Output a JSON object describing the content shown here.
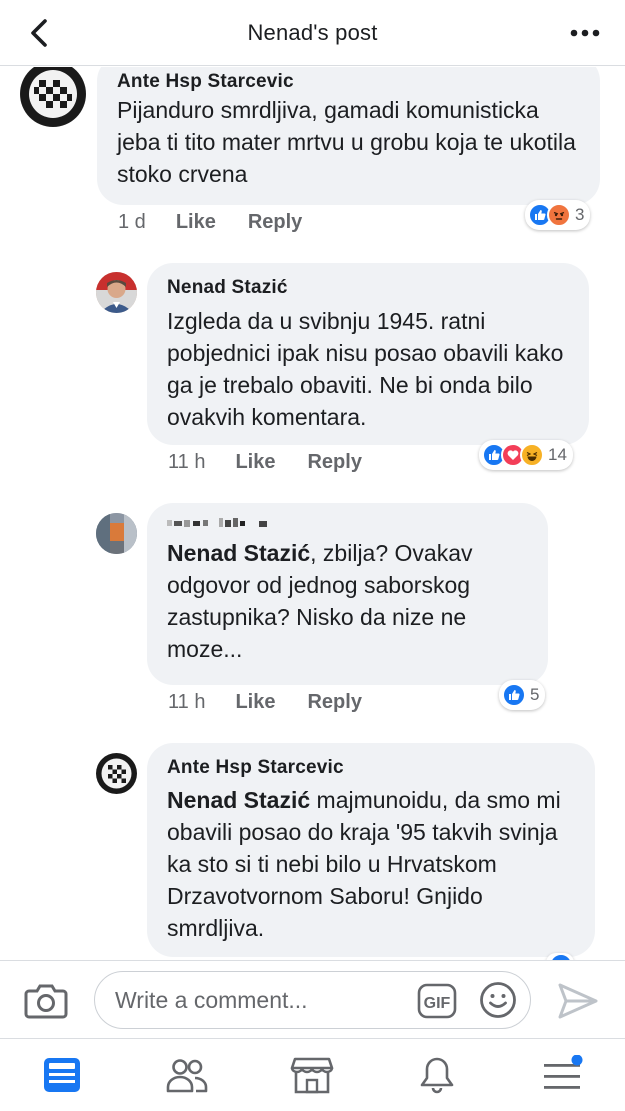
{
  "header": {
    "title": "Nenad's post",
    "back_icon": "chevron-left-icon",
    "more_icon": "more-dots-icon"
  },
  "comments": [
    {
      "author": "Ante Hsp Starcevic",
      "text": "Pijanduro smrdljiva, gamadi komunisticka jeba ti tito mater mrtvu u grobu koja te ukotila stoko crvena",
      "time": "1 d",
      "like": "Like",
      "reply": "Reply",
      "reactions": [
        "like",
        "angry"
      ],
      "reaction_count": "3"
    },
    {
      "author": "Nenad Stazić",
      "text": "Izgleda da u svibnju 1945. ratni pobjednici ipak nisu posao obavili kako ga je trebalo obaviti. Ne bi onda bilo ovakvih komentara.",
      "time": "11 h",
      "like": "Like",
      "reply": "Reply",
      "reactions": [
        "like",
        "love",
        "haha"
      ],
      "reaction_count": "14"
    },
    {
      "author": "",
      "mention": "Nenad Stazić",
      "text": ", zbilja? Ovakav odgovor od jednog saborskog zastupnika? Nisko da nize ne moze...",
      "time": "11 h",
      "like": "Like",
      "reply": "Reply",
      "reactions": [
        "like"
      ],
      "reaction_count": "5"
    },
    {
      "author": "Ante Hsp Starcevic",
      "mention": "Nenad Stazić",
      "text": " majmunoidu, da smo mi obavili posao do kraja '95 takvih svinja ka sto si ti nebi bilo u Hrvatskom Drzavotvornom Saboru!  Gnjido smrdljiva."
    }
  ],
  "composer": {
    "placeholder": "Write a comment...",
    "gif_label": "GIF"
  },
  "colors": {
    "accent": "#1877f2",
    "bubble": "#f0f2f5",
    "meta": "#65676b",
    "angry": "#f0743e",
    "love": "#f33e58",
    "haha": "#f7b125"
  },
  "nav": [
    "news-feed-icon",
    "friends-icon",
    "marketplace-icon",
    "notifications-icon",
    "menu-icon"
  ]
}
